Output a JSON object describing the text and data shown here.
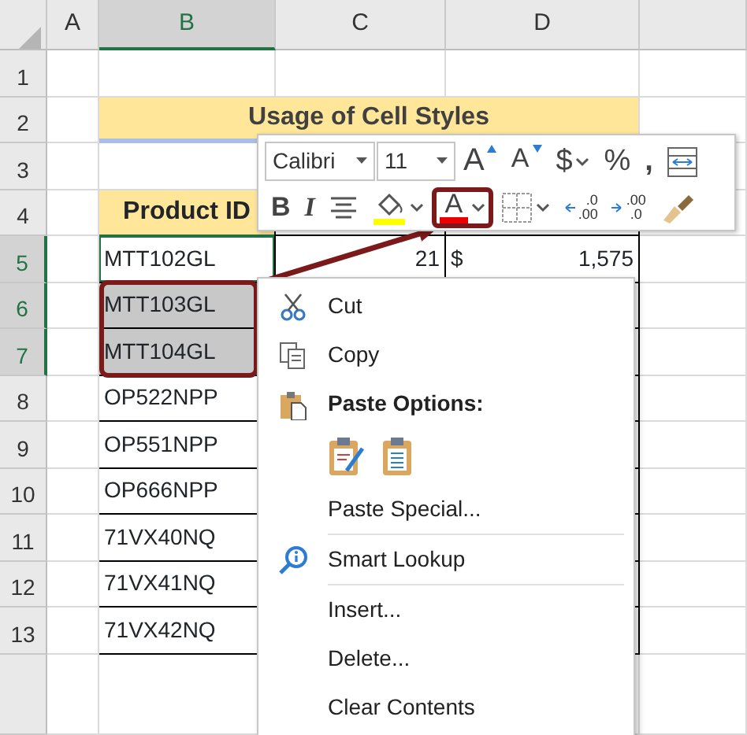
{
  "column_headers": [
    {
      "label": "A",
      "selected": false
    },
    {
      "label": "B",
      "selected": true
    },
    {
      "label": "C",
      "selected": false
    },
    {
      "label": "D",
      "selected": false
    }
  ],
  "row_headers": [
    {
      "label": "1",
      "selected": false
    },
    {
      "label": "2",
      "selected": false
    },
    {
      "label": "3",
      "selected": false
    },
    {
      "label": "4",
      "selected": false
    },
    {
      "label": "5",
      "selected": true
    },
    {
      "label": "6",
      "selected": true
    },
    {
      "label": "7",
      "selected": true
    },
    {
      "label": "8",
      "selected": false
    },
    {
      "label": "9",
      "selected": false
    },
    {
      "label": "10",
      "selected": false
    },
    {
      "label": "11",
      "selected": false
    },
    {
      "label": "12",
      "selected": false
    },
    {
      "label": "13",
      "selected": false
    }
  ],
  "title": "Usage of Cell Styles",
  "table": {
    "header": "Product ID",
    "rows": [
      {
        "product_id": "MTT102GL",
        "column_c": "21",
        "currency": "$",
        "column_d": "1,575",
        "selected": false,
        "active": true
      },
      {
        "product_id": "MTT103GL",
        "selected": true,
        "active": false
      },
      {
        "product_id": "MTT104GL",
        "selected": true,
        "active": false
      },
      {
        "product_id": "OP522NPP",
        "selected": false,
        "active": false
      },
      {
        "product_id": "OP551NPP",
        "selected": false,
        "active": false
      },
      {
        "product_id": "OP666NPP",
        "selected": false,
        "active": false
      },
      {
        "product_id": "71VX40NQ",
        "selected": false,
        "active": false
      },
      {
        "product_id": "71VX41NQ",
        "selected": false,
        "active": false
      },
      {
        "product_id": "71VX42NQ",
        "selected": false,
        "active": false
      }
    ]
  },
  "mini_toolbar": {
    "font": "Calibri",
    "size": "11",
    "row_1": [
      {
        "kind": "grow",
        "glyph": "A",
        "dropdown": false
      },
      {
        "kind": "shrink",
        "glyph": "A",
        "dropdown": false
      },
      {
        "kind": "currency",
        "glyph": "$",
        "dropdown": true
      },
      {
        "kind": "percent",
        "glyph": "%",
        "dropdown": false
      },
      {
        "kind": "comma",
        "glyph": ",",
        "dropdown": false
      },
      {
        "kind": "wrap",
        "dropdown": false
      }
    ],
    "row_2": [
      {
        "kind": "bold",
        "glyph": "B",
        "dropdown": false,
        "highlighted": false
      },
      {
        "kind": "italic",
        "glyph": "I",
        "dropdown": false,
        "highlighted": false
      },
      {
        "kind": "center",
        "dropdown": false,
        "highlighted": false
      },
      {
        "kind": "fill",
        "dropdown": true,
        "highlighted": false
      },
      {
        "kind": "font_color",
        "glyph": "A",
        "dropdown": true,
        "highlighted": true
      },
      {
        "kind": "borders",
        "dropdown": true,
        "highlighted": false
      },
      {
        "kind": "increase_decimal",
        "top": ".0",
        "bottom": ".00",
        "dropdown": false,
        "highlighted": false
      },
      {
        "kind": "decrease_decimal",
        "top": ".00",
        "bottom": ".0",
        "dropdown": false,
        "highlighted": false
      },
      {
        "kind": "painter",
        "dropdown": false,
        "highlighted": false
      }
    ]
  },
  "context_menu": {
    "items": [
      {
        "kind": "cut",
        "label": "Cut"
      },
      {
        "kind": "copy",
        "label": "Copy"
      },
      {
        "kind": "paste_header",
        "label": "Paste Options:"
      },
      {
        "kind": "paste_icons"
      },
      {
        "kind": "command",
        "label": "Paste Special..."
      },
      {
        "kind": "divider"
      },
      {
        "kind": "lookup",
        "label": "Smart Lookup"
      },
      {
        "kind": "divider"
      },
      {
        "kind": "command",
        "label": "Insert..."
      },
      {
        "kind": "command",
        "label": "Delete..."
      },
      {
        "kind": "command",
        "label": "Clear Contents"
      }
    ]
  }
}
